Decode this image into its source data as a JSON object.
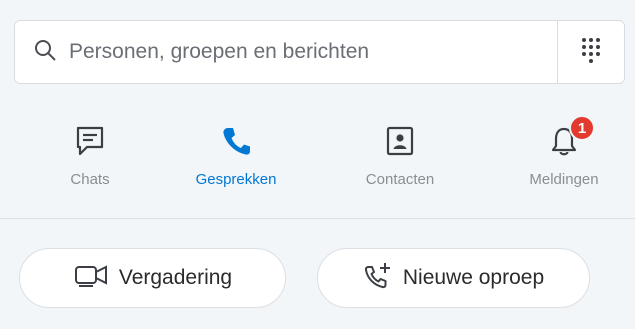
{
  "search": {
    "placeholder": "Personen, groepen en berichten",
    "value": ""
  },
  "nav": {
    "chats": "Chats",
    "calls": "Gesprekken",
    "contacts": "Contacten",
    "notifications": "Meldingen",
    "notifications_badge": "1",
    "active": "calls"
  },
  "actions": {
    "meeting": "Vergadering",
    "new_call": "Nieuwe oproep"
  },
  "icons": [
    "search-icon",
    "dialpad-icon",
    "chat-icon",
    "phone-icon",
    "contact-card-icon",
    "bell-icon",
    "video-camera-icon",
    "phone-add-icon"
  ],
  "colors": {
    "accent": "#0078d4",
    "badge": "#e23b2e",
    "background": "#f3f6f9"
  }
}
